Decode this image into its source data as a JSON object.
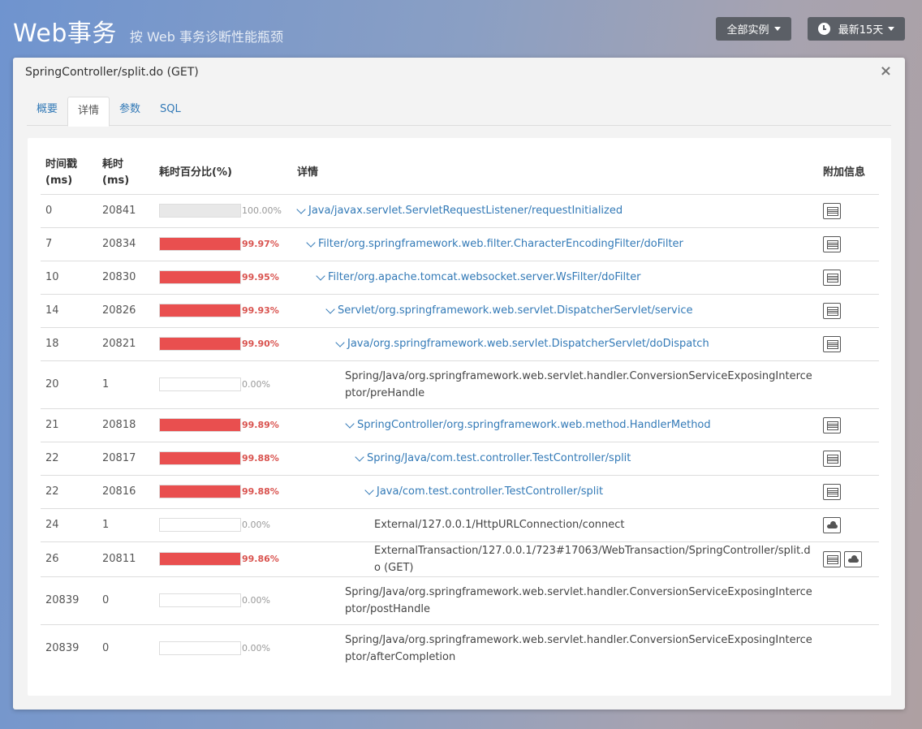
{
  "header": {
    "title": "Web事务",
    "subtitle": "按 Web 事务诊断性能瓶颈",
    "instance_button": "全部实例",
    "time_button": "最新15天"
  },
  "modal": {
    "title": "SpringController/split.do (GET)",
    "close": "×",
    "tabs": [
      "概要",
      "详情",
      "参数",
      "SQL"
    ],
    "active_tab": "详情"
  },
  "table": {
    "headers": {
      "timestamp": "时间戳\n(ms)",
      "duration": "耗时\n(ms)",
      "percent": "耗时百分比(%)",
      "detail": "详情",
      "extra": "附加信息"
    },
    "rows": [
      {
        "ts": "0",
        "dur": "20841",
        "pct": "100.00%",
        "pct_value": 100.0,
        "bar": "gray",
        "indent": 0,
        "expandable": true,
        "detail": "Java/javax.servlet.ServletRequestListener/requestInitialized",
        "icons": [
          "list"
        ]
      },
      {
        "ts": "7",
        "dur": "20834",
        "pct": "99.97%",
        "pct_value": 99.97,
        "bar": "red",
        "indent": 1,
        "expandable": true,
        "detail": "Filter/org.springframework.web.filter.CharacterEncodingFilter/doFilter",
        "icons": [
          "list"
        ]
      },
      {
        "ts": "10",
        "dur": "20830",
        "pct": "99.95%",
        "pct_value": 99.95,
        "bar": "red",
        "indent": 2,
        "expandable": true,
        "detail": "Filter/org.apache.tomcat.websocket.server.WsFilter/doFilter",
        "icons": [
          "list"
        ]
      },
      {
        "ts": "14",
        "dur": "20826",
        "pct": "99.93%",
        "pct_value": 99.93,
        "bar": "red",
        "indent": 3,
        "expandable": true,
        "detail": "Servlet/org.springframework.web.servlet.DispatcherServlet/service",
        "icons": [
          "list"
        ]
      },
      {
        "ts": "18",
        "dur": "20821",
        "pct": "99.90%",
        "pct_value": 99.9,
        "bar": "red",
        "indent": 4,
        "expandable": true,
        "detail": "Java/org.springframework.web.servlet.DispatcherServlet/doDispatch",
        "icons": [
          "list"
        ]
      },
      {
        "ts": "20",
        "dur": "1",
        "pct": "0.00%",
        "pct_value": 0,
        "bar": "empty",
        "indent": 5,
        "expandable": false,
        "detail": "Spring/Java/org.springframework.web.servlet.handler.ConversionServiceExposingInterceptor/preHandle",
        "icons": []
      },
      {
        "ts": "21",
        "dur": "20818",
        "pct": "99.89%",
        "pct_value": 99.89,
        "bar": "red",
        "indent": 5,
        "expandable": true,
        "detail": "SpringController/org.springframework.web.method.HandlerMethod",
        "icons": [
          "list"
        ]
      },
      {
        "ts": "22",
        "dur": "20817",
        "pct": "99.88%",
        "pct_value": 99.88,
        "bar": "red",
        "indent": 6,
        "expandable": true,
        "detail": "Spring/Java/com.test.controller.TestController/split",
        "icons": [
          "list"
        ]
      },
      {
        "ts": "22",
        "dur": "20816",
        "pct": "99.88%",
        "pct_value": 99.88,
        "bar": "red",
        "indent": 7,
        "expandable": true,
        "detail": "Java/com.test.controller.TestController/split",
        "icons": [
          "list"
        ]
      },
      {
        "ts": "24",
        "dur": "1",
        "pct": "0.00%",
        "pct_value": 0,
        "bar": "empty",
        "indent": 8,
        "expandable": false,
        "detail": "External/127.0.0.1/HttpURLConnection/connect",
        "icons": [
          "cloud"
        ]
      },
      {
        "ts": "26",
        "dur": "20811",
        "pct": "99.86%",
        "pct_value": 99.86,
        "bar": "red",
        "indent": 8,
        "expandable": false,
        "detail": "ExternalTransaction/127.0.0.1/723#17063/WebTransaction/SpringController/split.do (GET)",
        "icons": [
          "list",
          "cloud"
        ]
      },
      {
        "ts": "20839",
        "dur": "0",
        "pct": "0.00%",
        "pct_value": 0,
        "bar": "empty",
        "indent": 5,
        "expandable": false,
        "detail": "Spring/Java/org.springframework.web.servlet.handler.ConversionServiceExposingInterceptor/postHandle",
        "icons": []
      },
      {
        "ts": "20839",
        "dur": "0",
        "pct": "0.00%",
        "pct_value": 0,
        "bar": "empty",
        "indent": 5,
        "expandable": false,
        "detail": "Spring/Java/org.springframework.web.servlet.handler.ConversionServiceExposingInterceptor/afterCompletion",
        "icons": []
      }
    ]
  },
  "colors": {
    "accent": "#337ab7",
    "bar_red": "#e94f4f",
    "percent_red": "#d9534f"
  }
}
